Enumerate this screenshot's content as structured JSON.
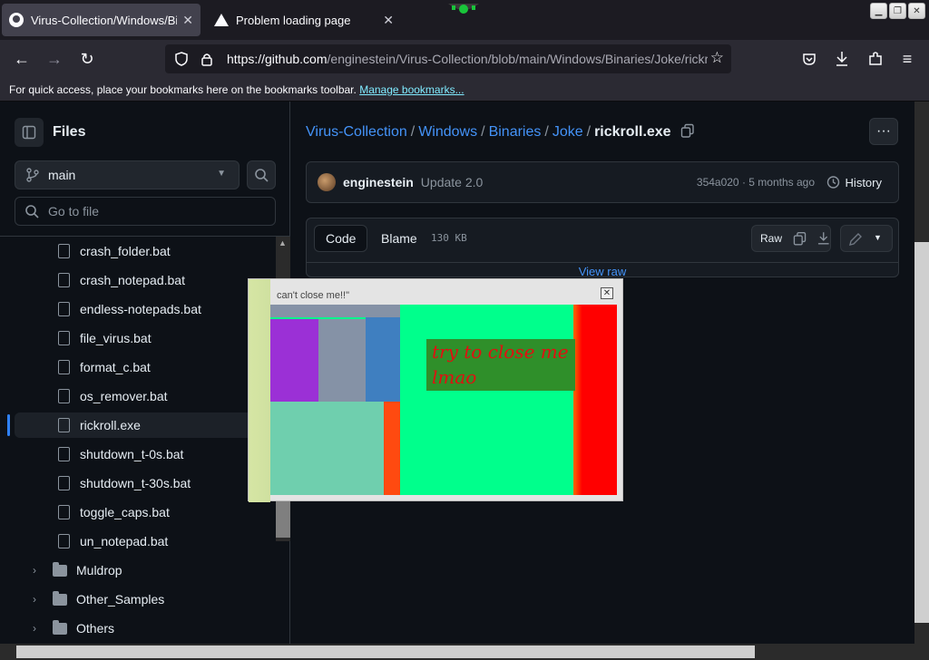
{
  "browser": {
    "tabs": [
      {
        "title": "Virus-Collection/Windows/Binaries/Joke/rickroll.exe",
        "active": true,
        "icon": "github-icon"
      },
      {
        "title": "Problem loading page",
        "active": false,
        "icon": "warning-icon"
      }
    ],
    "url_host": "https://github.com",
    "url_path": "/enginestein/Virus-Collection/blob/main/Windows/Binaries/Joke/rickroll.exe",
    "bookmarks_text": "For quick access, place your bookmarks here on the bookmarks toolbar.",
    "bookmarks_link": "Manage bookmarks..."
  },
  "sidebar": {
    "title": "Files",
    "branch": "main",
    "goto_placeholder": "Go to file",
    "files": [
      {
        "name": "crash_folder.bat"
      },
      {
        "name": "crash_notepad.bat"
      },
      {
        "name": "endless-notepads.bat"
      },
      {
        "name": "file_virus.bat"
      },
      {
        "name": "format_c.bat"
      },
      {
        "name": "os_remover.bat"
      },
      {
        "name": "rickroll.exe",
        "selected": true
      },
      {
        "name": "shutdown_t-0s.bat"
      },
      {
        "name": "shutdown_t-30s.bat"
      },
      {
        "name": "toggle_caps.bat"
      },
      {
        "name": "un_notepad.bat"
      }
    ],
    "folders": [
      {
        "name": "Muldrop"
      },
      {
        "name": "Other_Samples"
      },
      {
        "name": "Others"
      }
    ]
  },
  "breadcrumb": {
    "parts": [
      "Virus-Collection",
      "Windows",
      "Binaries",
      "Joke"
    ],
    "current": "rickroll.exe"
  },
  "commit": {
    "author": "enginestein",
    "message": "Update 2.0",
    "hash_time": "354a020 · 5 months ago",
    "history_label": "History"
  },
  "file": {
    "code_tab": "Code",
    "blame_tab": "Blame",
    "size": "130 KB",
    "raw_label": "Raw",
    "view_raw": "View raw"
  },
  "popup": {
    "caption": "can't close me!!\"",
    "close_glyph": "✕",
    "joke_line1": "try to close me",
    "joke_line2": "lmao"
  },
  "colors": {
    "link": "#4493f8",
    "popup_green": "#00ff8c",
    "popup_red": "#ff0000"
  }
}
